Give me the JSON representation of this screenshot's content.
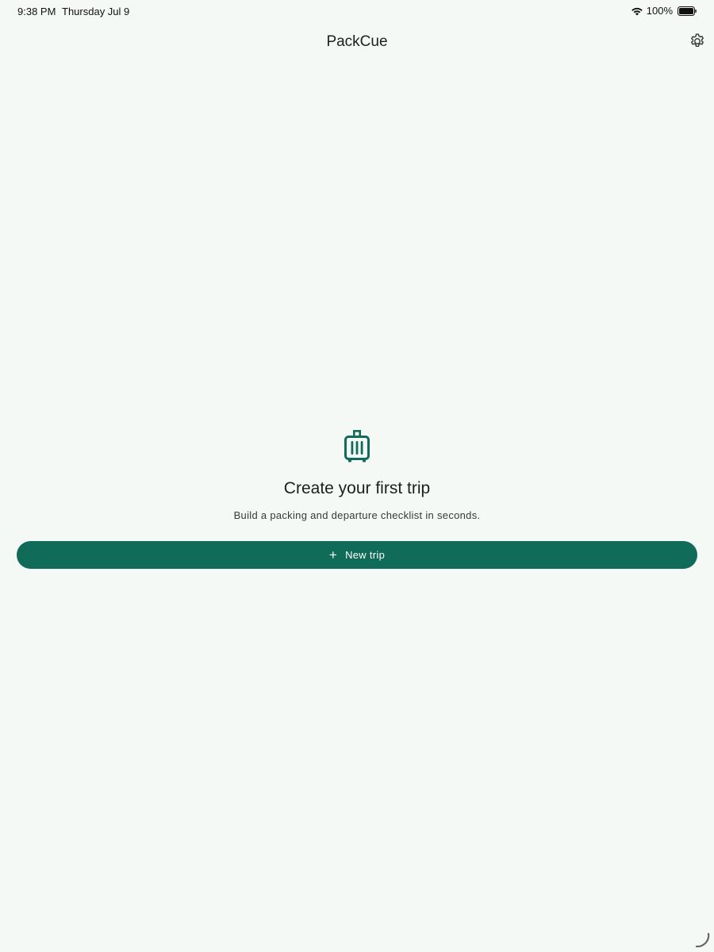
{
  "status_bar": {
    "time": "9:38 PM",
    "date": "Thursday Jul 9",
    "battery": "100%",
    "icons": [
      "wifi-icon",
      "battery-icon"
    ]
  },
  "app_bar": {
    "title": "PackCue",
    "settings_icon": "gear-icon"
  },
  "empty_state": {
    "icon": "suitcase-icon",
    "title": "Create your first trip",
    "subtitle": "Build a packing and departure checklist in seconds."
  },
  "new_trip_button": {
    "icon": "plus-icon",
    "label": "New trip"
  },
  "colors": {
    "background": "#f4f9f6",
    "accent": "#116b59",
    "on_accent": "#ffffff"
  }
}
